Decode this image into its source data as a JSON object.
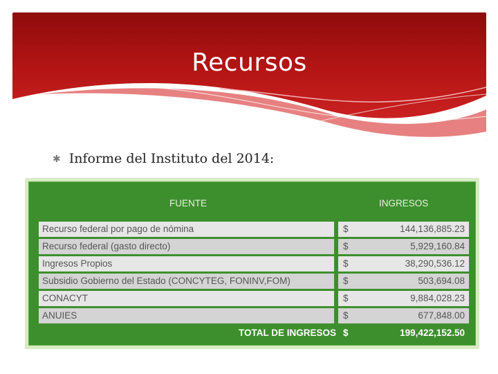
{
  "slide": {
    "title": "Recursos",
    "bullet": "Informe del Instituto del 2014:"
  },
  "colors": {
    "header_red": "#b51515",
    "table_green": "#3d8f2d",
    "cell_gray": "#e6e6e6"
  },
  "table": {
    "headers": {
      "fuente": "FUENTE",
      "ingresos": "INGRESOS"
    },
    "rows": [
      {
        "fuente": "Recurso federal por pago de nómina",
        "currency": "$",
        "ingreso": "144,136,885.23"
      },
      {
        "fuente": "Recurso federal (gasto directo)",
        "currency": "$",
        "ingreso": "5,929,160.84"
      },
      {
        "fuente": "Ingresos Propios",
        "currency": "$",
        "ingreso": "38,290,536.12"
      },
      {
        "fuente": "Subsidio Gobierno del Estado (CONCYTEG, FONINV,FOM)",
        "currency": "$",
        "ingreso": "503,694.08"
      },
      {
        "fuente": "CONACYT",
        "currency": "$",
        "ingreso": "9,884,028.23"
      },
      {
        "fuente": "ANUIES",
        "currency": "$",
        "ingreso": "677,848.00"
      }
    ],
    "total": {
      "label": "TOTAL DE INGRESOS",
      "currency": "$",
      "ingreso": "199,422,152.50"
    }
  }
}
